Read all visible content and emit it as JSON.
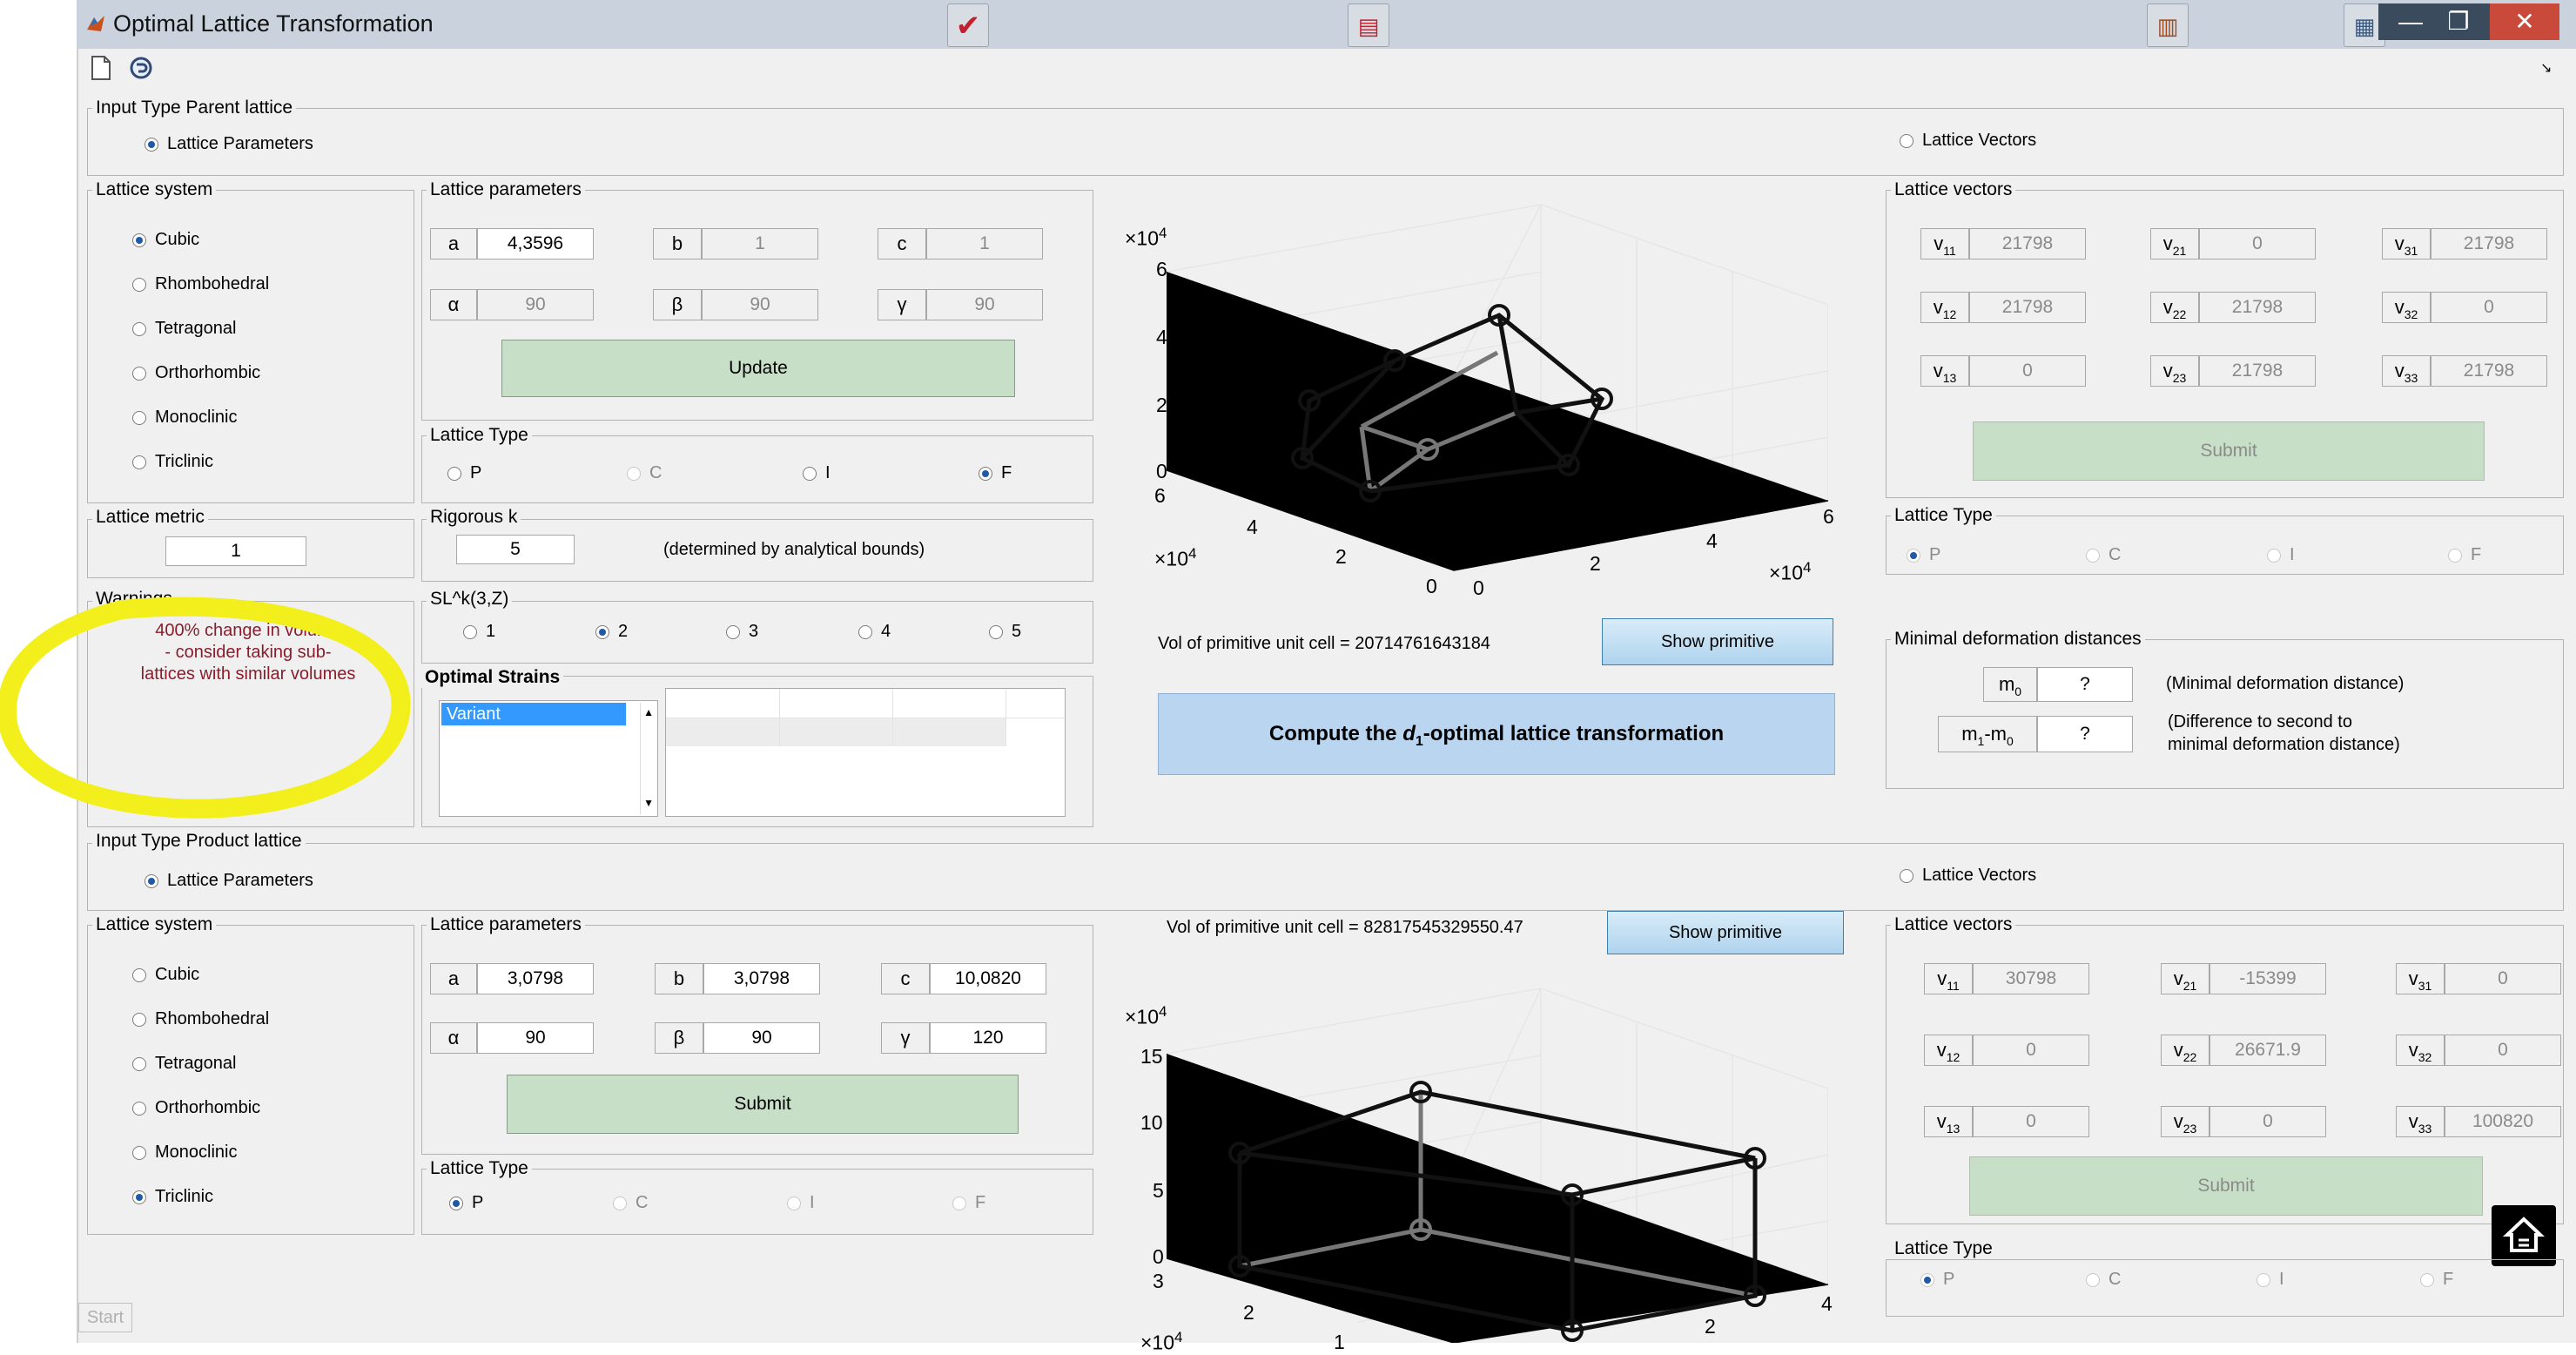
{
  "window": {
    "title": "Optimal Lattice Transformation",
    "close": "✕",
    "restore": "❐",
    "minimize": "—"
  },
  "parent": {
    "input_type_title": "Input Type Parent lattice",
    "input_type_options": [
      "Lattice Parameters",
      "Lattice Vectors"
    ],
    "lattice_system": {
      "title": "Lattice system",
      "options": [
        "Cubic",
        "Rhombohedral",
        "Tetragonal",
        "Orthorhombic",
        "Monoclinic",
        "Triclinic"
      ],
      "selected": "Cubic"
    },
    "lattice_params": {
      "title": "Lattice parameters",
      "labels": {
        "a": "a",
        "b": "b",
        "c": "c",
        "alpha": "α",
        "beta": "β",
        "gamma": "γ"
      },
      "values": {
        "a": "4,3596",
        "b": "1",
        "c": "1",
        "alpha": "90",
        "beta": "90",
        "gamma": "90"
      },
      "button": "Update"
    },
    "lattice_type": {
      "title": "Lattice Type",
      "options": [
        "P",
        "C",
        "I",
        "F"
      ],
      "selected": "F"
    },
    "lattice_metric": {
      "title": "Lattice metric",
      "value": "1"
    },
    "rigorous": {
      "title": "Rigorous k",
      "value": "5",
      "note": "(determined by analytical bounds)"
    },
    "warnings": {
      "title": "Warnings",
      "lines": [
        "400% change in volume",
        "- consider taking sub-",
        "lattices with similar volumes"
      ]
    },
    "sl": {
      "title": "SL^k(3,Z)",
      "options": [
        "1",
        "2",
        "3",
        "4",
        "5"
      ],
      "selected": "2"
    },
    "optimal_strains": {
      "title": "Optimal Strains",
      "list_items": [
        "Variant"
      ]
    },
    "plot": {
      "z_mult": "×10",
      "z_mult_exp": "4",
      "z_ticks": [
        "6",
        "4",
        "2",
        "0"
      ],
      "y_ticks": [
        "6",
        "4",
        "2",
        "0"
      ],
      "x_ticks": [
        "0",
        "2",
        "4",
        "6"
      ],
      "y_mult": "×10",
      "y_mult_exp": "4",
      "x_mult": "×10",
      "x_mult_exp": "4"
    },
    "vol_text": "Vol of primitive unit cell = 20714761643184",
    "show_primitive": "Show primitive",
    "compute": {
      "prefix": "Compute the ",
      "d": "d",
      "sub": "1",
      "suffix": "-optimal lattice transformation"
    },
    "vectors": {
      "title": "Lattice vectors",
      "rows": [
        [
          {
            "l": "v",
            "s": "11",
            "v": "21798"
          },
          {
            "l": "v",
            "s": "21",
            "v": "0"
          },
          {
            "l": "v",
            "s": "31",
            "v": "21798"
          }
        ],
        [
          {
            "l": "v",
            "s": "12",
            "v": "21798"
          },
          {
            "l": "v",
            "s": "22",
            "v": "21798"
          },
          {
            "l": "v",
            "s": "32",
            "v": "0"
          }
        ],
        [
          {
            "l": "v",
            "s": "13",
            "v": "0"
          },
          {
            "l": "v",
            "s": "23",
            "v": "21798"
          },
          {
            "l": "v",
            "s": "33",
            "v": "21798"
          }
        ]
      ],
      "submit": "Submit"
    },
    "right_lattice_type": {
      "title": "Lattice Type",
      "options": [
        "P",
        "C",
        "I",
        "F"
      ]
    },
    "minimal": {
      "title": "Minimal deformation distances",
      "m0_label": "m",
      "m0_sub": "0",
      "m0_value": "?",
      "m0_note": "(Minimal deformation distance)",
      "m1_label": "m",
      "m1_sub": "1",
      "m1_minus": "-m",
      "m1_sub2": "0",
      "m1_value": "?",
      "m1_note_1": "(Difference to second to",
      "m1_note_2": "minimal deformation distance)"
    }
  },
  "product": {
    "input_type_title": "Input Type Product lattice",
    "input_type_options": [
      "Lattice Parameters",
      "Lattice Vectors"
    ],
    "lattice_system": {
      "title": "Lattice system",
      "options": [
        "Cubic",
        "Rhombohedral",
        "Tetragonal",
        "Orthorhombic",
        "Monoclinic",
        "Triclinic"
      ],
      "selected": "Triclinic"
    },
    "lattice_params": {
      "title": "Lattice parameters",
      "labels": {
        "a": "a",
        "b": "b",
        "c": "c",
        "alpha": "α",
        "beta": "β",
        "gamma": "γ"
      },
      "values": {
        "a": "3,0798",
        "b": "3,0798",
        "c": "10,0820",
        "alpha": "90",
        "beta": "90",
        "gamma": "120"
      },
      "button": "Submit"
    },
    "lattice_type": {
      "title": "Lattice Type",
      "options": [
        "P",
        "C",
        "I",
        "F"
      ],
      "selected": "P"
    },
    "vol_text": "Vol of primitive unit cell = 82817545329550.47",
    "show_primitive": "Show primitive",
    "plot": {
      "z_mult": "×10",
      "z_mult_exp": "4",
      "z_ticks": [
        "15",
        "10",
        "5",
        "0"
      ],
      "y_ticks": [
        "3",
        "2",
        "1"
      ],
      "x_ticks": [
        "2",
        "4"
      ],
      "y_mult": "×10",
      "y_mult_exp": "4"
    },
    "vectors": {
      "title": "Lattice vectors",
      "rows": [
        [
          {
            "l": "v",
            "s": "11",
            "v": "30798"
          },
          {
            "l": "v",
            "s": "21",
            "v": "-15399"
          },
          {
            "l": "v",
            "s": "31",
            "v": "0"
          }
        ],
        [
          {
            "l": "v",
            "s": "12",
            "v": "0"
          },
          {
            "l": "v",
            "s": "22",
            "v": "26671.9"
          },
          {
            "l": "v",
            "s": "32",
            "v": "0"
          }
        ],
        [
          {
            "l": "v",
            "s": "13",
            "v": "0"
          },
          {
            "l": "v",
            "s": "23",
            "v": "0"
          },
          {
            "l": "v",
            "s": "33",
            "v": "100820"
          }
        ]
      ],
      "submit": "Submit"
    },
    "right_lattice_type": {
      "title": "Lattice Type",
      "options": [
        "P",
        "C",
        "I",
        "F"
      ]
    }
  },
  "start_button": "Start"
}
